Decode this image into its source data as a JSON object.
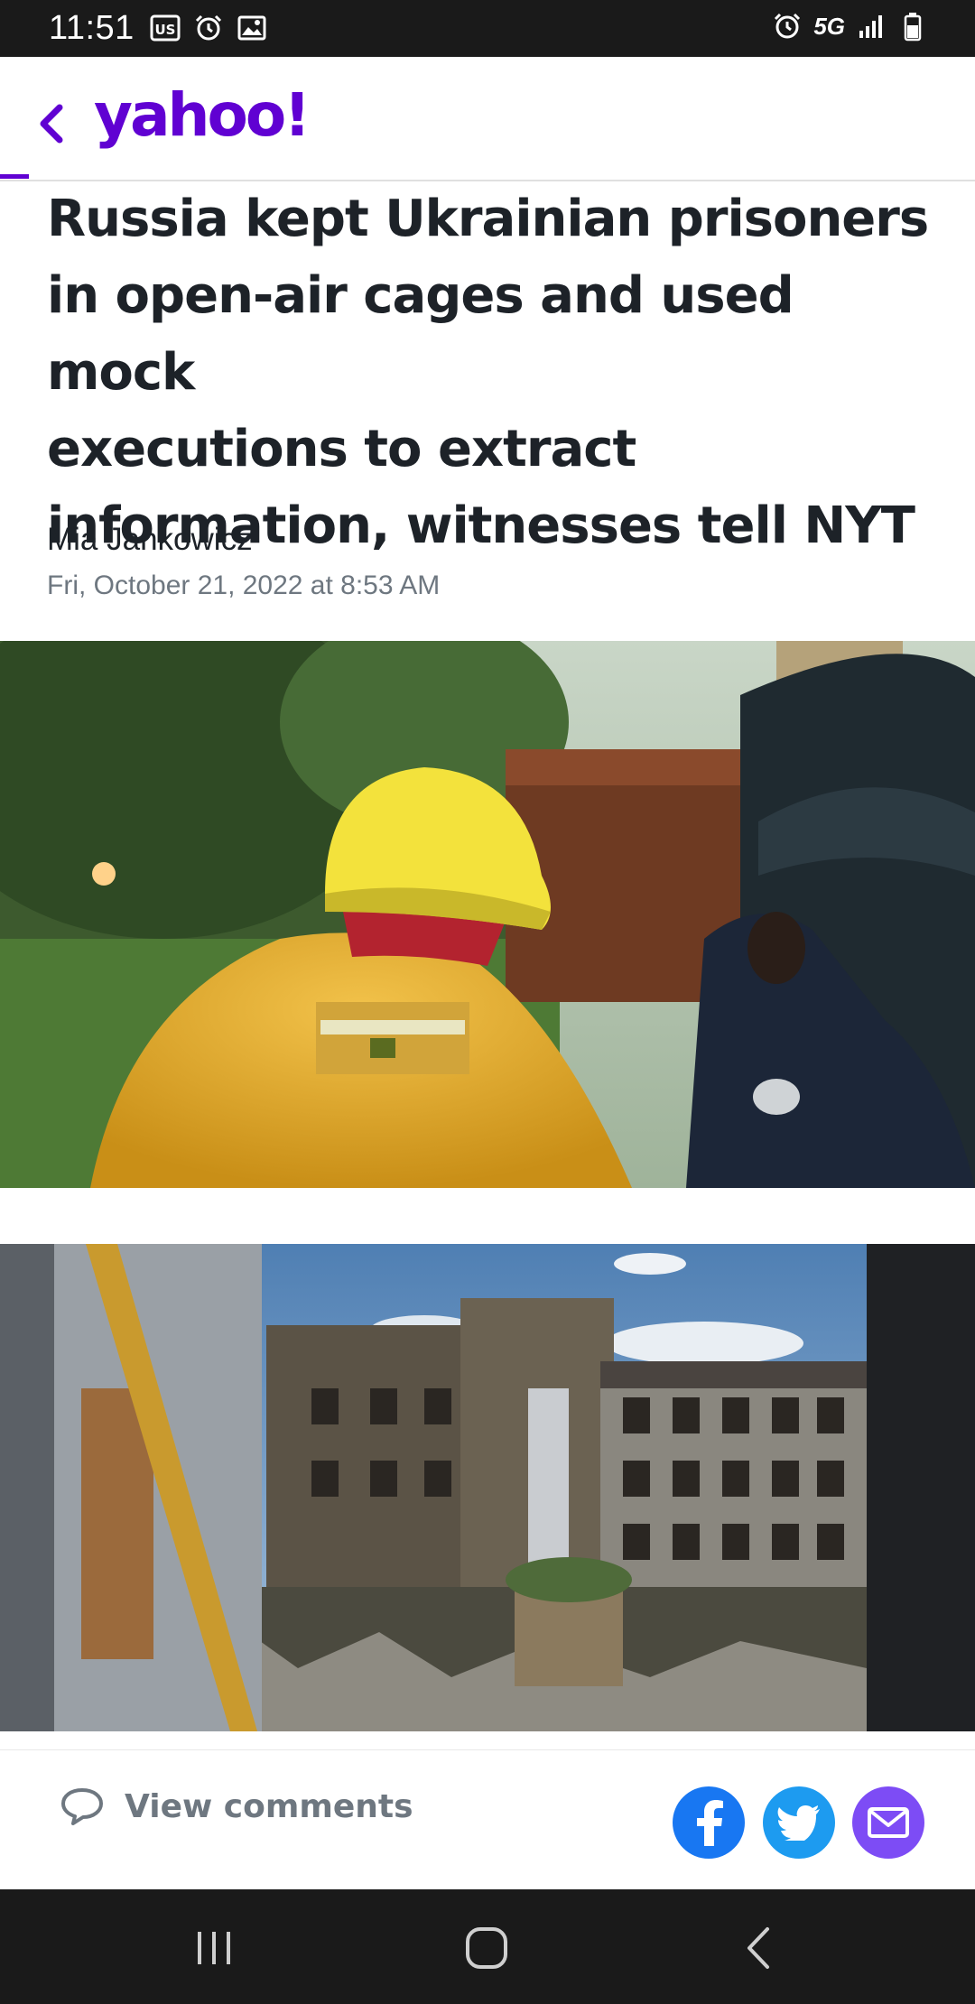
{
  "status_bar": {
    "time": "11:51",
    "network": "5G",
    "icons": [
      "us-news-icon",
      "alarm-icon",
      "image-icon",
      "alarm-icon",
      "signal-icon",
      "battery-icon"
    ]
  },
  "header": {
    "logo": "yahoo!",
    "brand_color": "#6001d2"
  },
  "article": {
    "headline_lines": [
      "Russia kept Ukrainian prisoners",
      "in open-air cages and used mock",
      "executions to extract",
      "information, witnesses tell NYT"
    ],
    "author": "Mia Jankowicz",
    "date": "Fri, October 21, 2022 at 8:53 AM"
  },
  "actions": {
    "comments_label": "View comments",
    "share_colors": {
      "facebook": "#1877f2",
      "twitter": "#1d9bf0",
      "email": "#7d4cf5"
    }
  },
  "nav": {
    "icons": [
      "recent-apps-icon",
      "home-icon",
      "back-icon"
    ]
  }
}
